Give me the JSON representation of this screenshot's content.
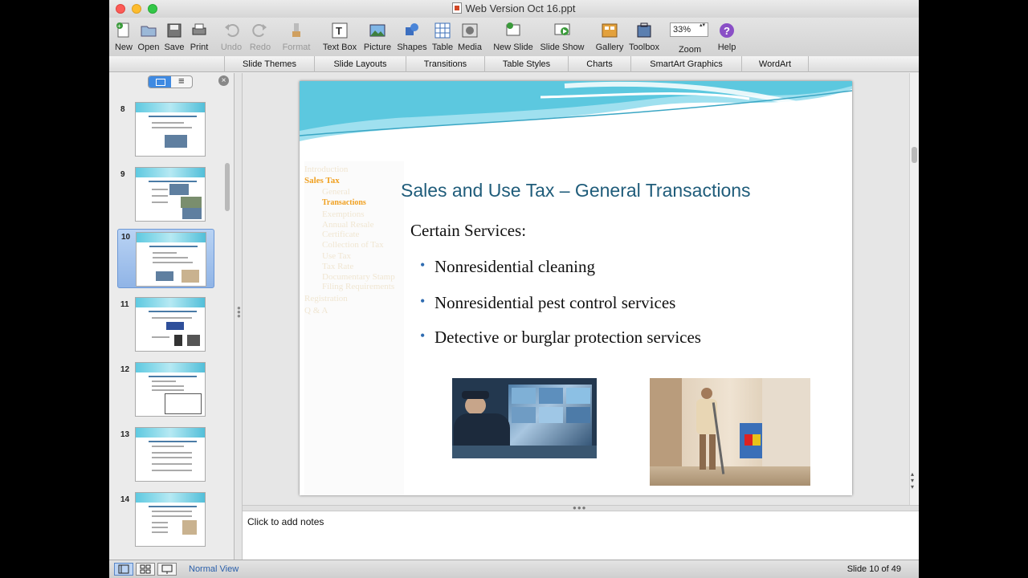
{
  "window": {
    "title": "Web Version Oct 16.ppt"
  },
  "toolbar": {
    "new": "New",
    "open": "Open",
    "save": "Save",
    "print": "Print",
    "undo": "Undo",
    "redo": "Redo",
    "format": "Format",
    "text_box": "Text Box",
    "picture": "Picture",
    "shapes": "Shapes",
    "table": "Table",
    "media": "Media",
    "new_slide": "New Slide",
    "slide_show": "Slide Show",
    "gallery": "Gallery",
    "toolbox": "Toolbox",
    "zoom_value": "33%",
    "zoom": "Zoom",
    "help": "Help"
  },
  "ribbon": {
    "tabs": [
      "Slide Themes",
      "Slide Layouts",
      "Transitions",
      "Table Styles",
      "Charts",
      "SmartArt Graphics",
      "WordArt"
    ]
  },
  "sidebar": {
    "slides": [
      {
        "number": "8"
      },
      {
        "number": "9"
      },
      {
        "number": "10"
      },
      {
        "number": "11"
      },
      {
        "number": "12"
      },
      {
        "number": "13"
      },
      {
        "number": "14"
      }
    ],
    "selected_slide": "10"
  },
  "slide": {
    "title": "Sales and Use Tax – General Transactions",
    "subtitle": "Certain Services:",
    "bullets": [
      "Nonresidential cleaning",
      "Nonresidential pest control services",
      "Detective or burglar protection services"
    ],
    "outline": [
      "Introduction",
      "Sales Tax",
      "General",
      "Transactions",
      "Exemptions",
      "Annual Resale",
      "Certificate",
      "Collection of Tax",
      "Use Tax",
      "Tax Rate",
      "Documentary Stamp",
      "Filing Requirements",
      "Registration",
      "Q & A"
    ],
    "active_outline": "Sales Tax",
    "accent_color": "#1f5c7a"
  },
  "notes": {
    "placeholder": "Click to add notes"
  },
  "status": {
    "view": "Normal View",
    "slide_counter": "Slide 10 of 49"
  }
}
